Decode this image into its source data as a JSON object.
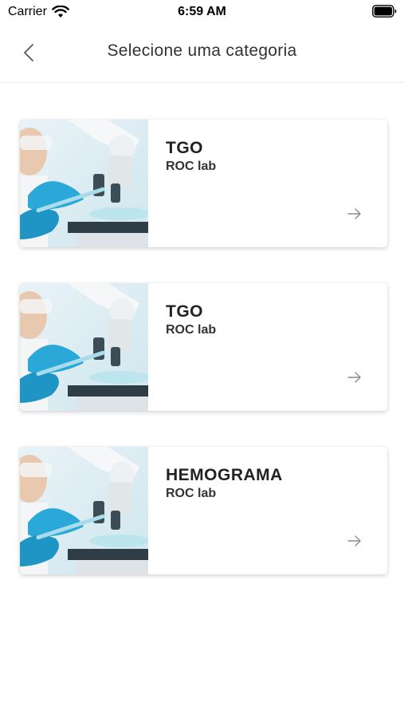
{
  "status_bar": {
    "carrier": "Carrier",
    "time": "6:59 AM",
    "wifi_icon": "wifi-icon",
    "battery_icon": "battery-icon"
  },
  "nav": {
    "title": "Selecione uma categoria",
    "back_icon": "chevron-left-icon"
  },
  "categories": [
    {
      "title": "TGO",
      "subtitle": "ROC lab",
      "image": "microscope-lab-photo",
      "arrow_icon": "arrow-right-icon"
    },
    {
      "title": "TGO",
      "subtitle": "ROC lab",
      "image": "microscope-lab-photo",
      "arrow_icon": "arrow-right-icon"
    },
    {
      "title": "HEMOGRAMA",
      "subtitle": "ROC lab",
      "image": "microscope-lab-photo",
      "arrow_icon": "arrow-right-icon"
    }
  ],
  "colors": {
    "background": "#ffffff",
    "glove_blue": "#2aa8d8",
    "text_dark": "#222222",
    "arrow_gray": "#8a8a8a"
  }
}
